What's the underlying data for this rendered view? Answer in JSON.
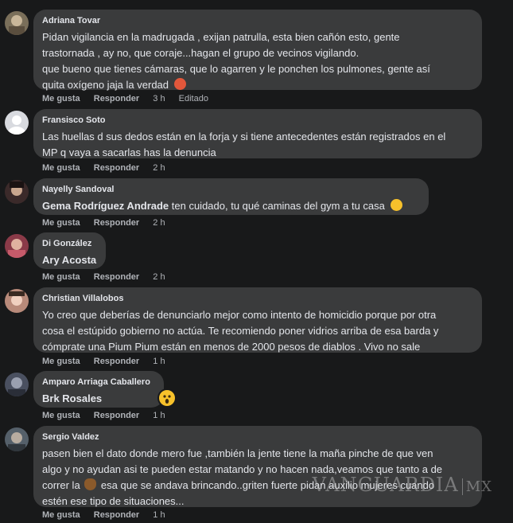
{
  "comments": [
    {
      "author": "Adriana Tovar",
      "lines": [
        "Pidan vigilancia en la madrugada , exijan patrulla, esta bien cañón esto, gente",
        "trastornada , ay no, que coraje...hagan el grupo de vecinos vigilando.",
        "que bueno que tienes cámaras, que lo agarren y le ponchen los pulmones, gente así",
        "quita oxígeno jaja la verdad"
      ],
      "like": "Me gusta",
      "reply": "Responder",
      "time": "3 h",
      "edited": "Editado",
      "avatar_color": "#7a6f5a"
    },
    {
      "author": "Fransisco Soto",
      "lines": [
        "Las huellas d sus dedos están en la forja y si tiene antecedentes están registrados en el",
        "MP q vaya a sacarlas has la denuncia"
      ],
      "like": "Me gusta",
      "reply": "Responder",
      "time": "2 h",
      "avatar_color": "#d8dadf"
    },
    {
      "author": "Nayelly Sandoval",
      "mention": "Gema Rodríguez Andrade",
      "text": " ten cuidado, tu qué caminas del gym a tu casa",
      "like": "Me gusta",
      "reply": "Responder",
      "time": "2 h",
      "avatar_color": "#3b2a2a"
    },
    {
      "author": "Di González",
      "mention": "Ary Acosta",
      "like": "Me gusta",
      "reply": "Responder",
      "time": "2 h",
      "avatar_color": "#8a3a48"
    },
    {
      "author": "Christian Villalobos",
      "lines": [
        "Yo creo que deberías de denunciarlo mejor como intento de homicidio porque por otra",
        "cosa el estúpido gobierno no actúa. Te recomiendo poner vidrios arriba de esa barda y",
        "cómprate una Pium Pium están en menos de 2000 pesos de diablos . Vivo no sale"
      ],
      "like": "Me gusta",
      "reply": "Responder",
      "time": "1 h",
      "avatar_color": "#b88a7a"
    },
    {
      "author": "Amparo Arriaga Caballero",
      "mention": "Brk Rosales",
      "like": "Me gusta",
      "reply": "Responder",
      "time": "1 h",
      "avatar_color": "#4a5060"
    },
    {
      "author": "Sergio Valdez",
      "lines": [
        "pasen bien el dato donde mero fue ,también la jente tiene la maña pinche de que ven",
        "algo y no ayudan asi te pueden estar matando y no hacen nada,veamos que tanto a de",
        "correr la",
        " esa que se andava brincando..griten fuerte pidan auxilio mujeres cuando",
        "estén ese tipo de situaciones..."
      ],
      "like": "Me gusta",
      "reply": "Responder",
      "time": "1 h",
      "avatar_color": "#55606a"
    }
  ],
  "watermark": {
    "brand": "VANGUARDIA",
    "suffix": "MX"
  },
  "colors": {
    "background": "#18191a",
    "bubble": "#3a3b3c",
    "text": "#e4e6eb",
    "meta": "#b0b3b8"
  }
}
